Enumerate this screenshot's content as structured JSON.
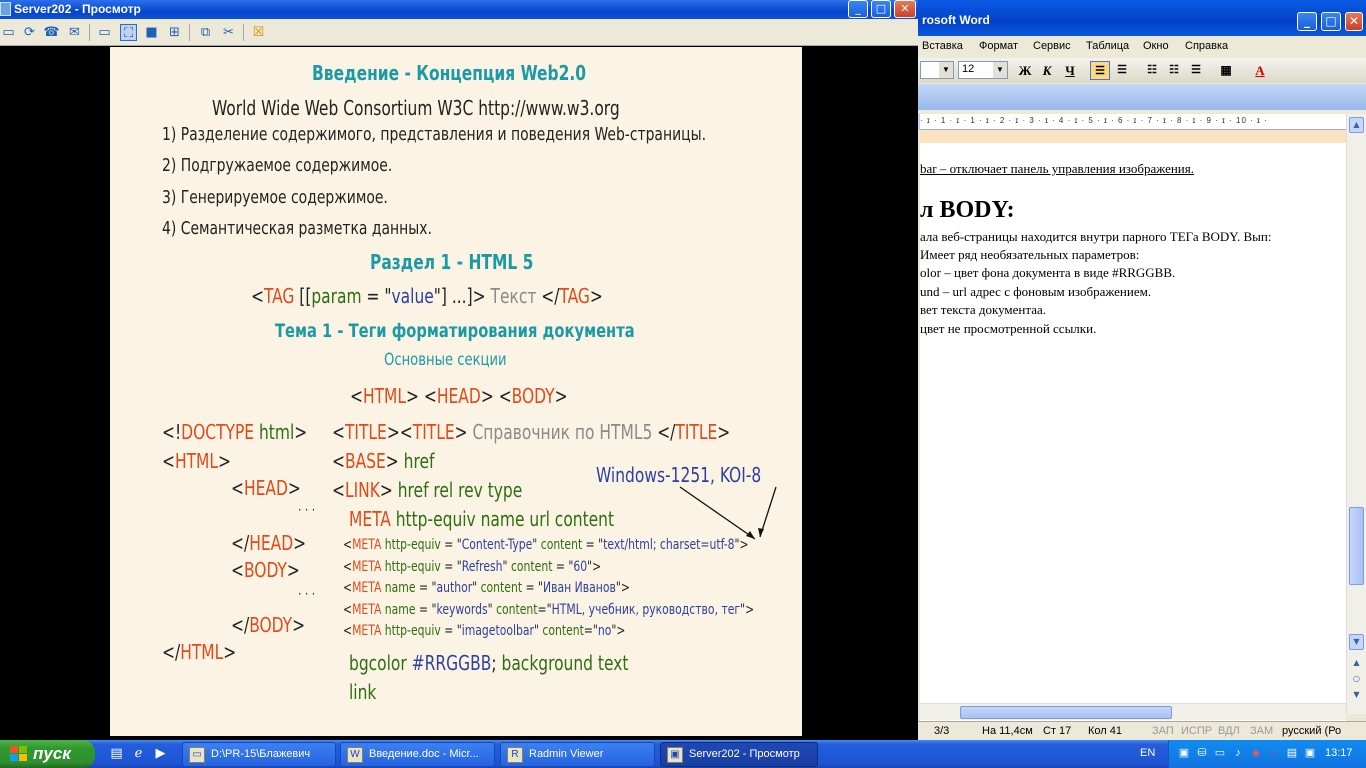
{
  "word": {
    "title": "rosoft Word",
    "menu": [
      "Вставка",
      "Формат",
      "Сервис",
      "Таблица",
      "Окно",
      "Справка"
    ],
    "font_size": "12",
    "fmt_bold": "Ж",
    "fmt_italic": "К",
    "fmt_underline": "Ч",
    "ruler": "· ɪ · 1 · ɪ · 1 · ɪ · 2 · ɪ · 3 · ɪ · 4 · ɪ · 5 · ɪ · 6 · ɪ · 7 · ɪ · 8 · ɪ · 9 · ɪ · 10 · ɪ ·",
    "doc": {
      "line1": "bar – отключает панель управления изображения.",
      "heading": "л BODY:",
      "line2": "ала веб-страницы находится внутри парного ТЕГа BODY. Вып:",
      "line3": "Имеет ряд необязательных параметров:",
      "line4": "olor – цвет фона документа в виде #RRGGBB.",
      "line5": "und – url адрес с фоновым изображением.",
      "line6": "вет текста документаа.",
      "line7": "цвет не просмотренной ссылки."
    },
    "status": {
      "pages": "3/3",
      "at": "На 11,4см",
      "line": "Ст 17",
      "col": "Кол 41",
      "rec": "ЗАП",
      "trk": "ИСПР",
      "ext": "ВДЛ",
      "ovr": "ЗАМ",
      "lang": "русский (Ро"
    }
  },
  "viewer": {
    "title": "Server202 - Просмотр"
  },
  "slide": {
    "title": "Введение - Концепция Web2.0",
    "w3c": "World Wide Web Consortium   W3C   http://www.w3.org",
    "items": [
      "1) Разделение содержимого, представления и поведения Web-страницы.",
      "2) Подгружаемое содержимое.",
      "3) Генерируемое содержимое.",
      "4) Семантическая разметка данных."
    ],
    "section": "Раздел 1 - HTML 5",
    "tag_syntax": {
      "lt": "<",
      "tag": "TAG",
      "b1": " [[",
      "param": "param",
      "eq": " = \"",
      "value": "value",
      "b2": "\"] ...]>",
      "text": " Текст ",
      "close_lt": "</",
      "close_tag": "TAG",
      "gt": ">"
    },
    "topic": "Тема 1 - Теги форматирования документа",
    "subtopic": "Основные секции",
    "sections_line": {
      "lt1": "<",
      "html": "HTML",
      "gt1": ">",
      "lt2": "<",
      "head": "HEAD",
      "gt2": ">",
      "lt3": "<",
      "body": "BODY",
      "gt3": ">"
    },
    "left": {
      "doctype_lt": "<!",
      "doctype": "DOCTYPE",
      "doctype_rest": " html",
      "html_open": "HTML",
      "head_open": "HEAD",
      "dots": "· · ·",
      "head_close": "HEAD",
      "body_open": "BODY",
      "body_close": "BODY",
      "html_close": "HTML"
    },
    "right": {
      "title_tag": "TITLE",
      "title_text": " Справочник по HTML5 ",
      "base_tag": "BASE",
      "base_attr": "href",
      "link_tag": "LINK",
      "link_attrs": "href  rel  rev  type",
      "meta_tag": "META",
      "meta_attrs": "http-equiv  name  url  content",
      "encoding_note": "Windows-1251, KOI-8",
      "meta_lines": [
        {
          "tag": "META",
          "a1": "http-equiv",
          "eq1": " = \"",
          "v1": "Content-Type",
          "q1": "\" ",
          "a2": "content",
          "eq2": " = \"",
          "v2": "text/html; charset=utf-8",
          "q2": "\">"
        },
        {
          "tag": "META",
          "a1": "http-equiv",
          "eq1": " = \"",
          "v1": "Refresh",
          "q1": "\" ",
          "a2": "content",
          "eq2": " = \"",
          "v2": "60",
          "q2": "\">"
        },
        {
          "tag": "META",
          "a1": "name",
          "eq1": " = \"",
          "v1": "author",
          "q1": "\" ",
          "a2": "content",
          "eq2": " = \"",
          "v2": "Иван Иванов",
          "q2": "\">"
        },
        {
          "tag": "META",
          "a1": "name",
          "eq1": " = \"",
          "v1": "keywords",
          "q1": "\" ",
          "a2": "content",
          "eq2": "=\"",
          "v2": "HTML, учебник, руководство, тег",
          "q2": "\">"
        },
        {
          "tag": "META",
          "a1": "http-equiv",
          "eq1": " = \"",
          "v1": "imagetoolbar",
          "q1": "\" ",
          "a2": "content",
          "eq2": "=\"",
          "v2": "no",
          "q2": "\">"
        }
      ],
      "bgcolor": "bgcolor",
      "rrggbb": "#RRGGBB",
      "semi": ";",
      "bg_attrs": "background   text",
      "link": "link"
    }
  },
  "taskbar": {
    "start": "пуск",
    "tasks": [
      {
        "label": "D:\\PR-15\\Блажевич"
      },
      {
        "label": "Введение.doc - Micr..."
      },
      {
        "label": "Radmin Viewer"
      },
      {
        "label": "Server202 - Просмотр"
      }
    ],
    "lang": "EN",
    "clock": "13:17"
  }
}
